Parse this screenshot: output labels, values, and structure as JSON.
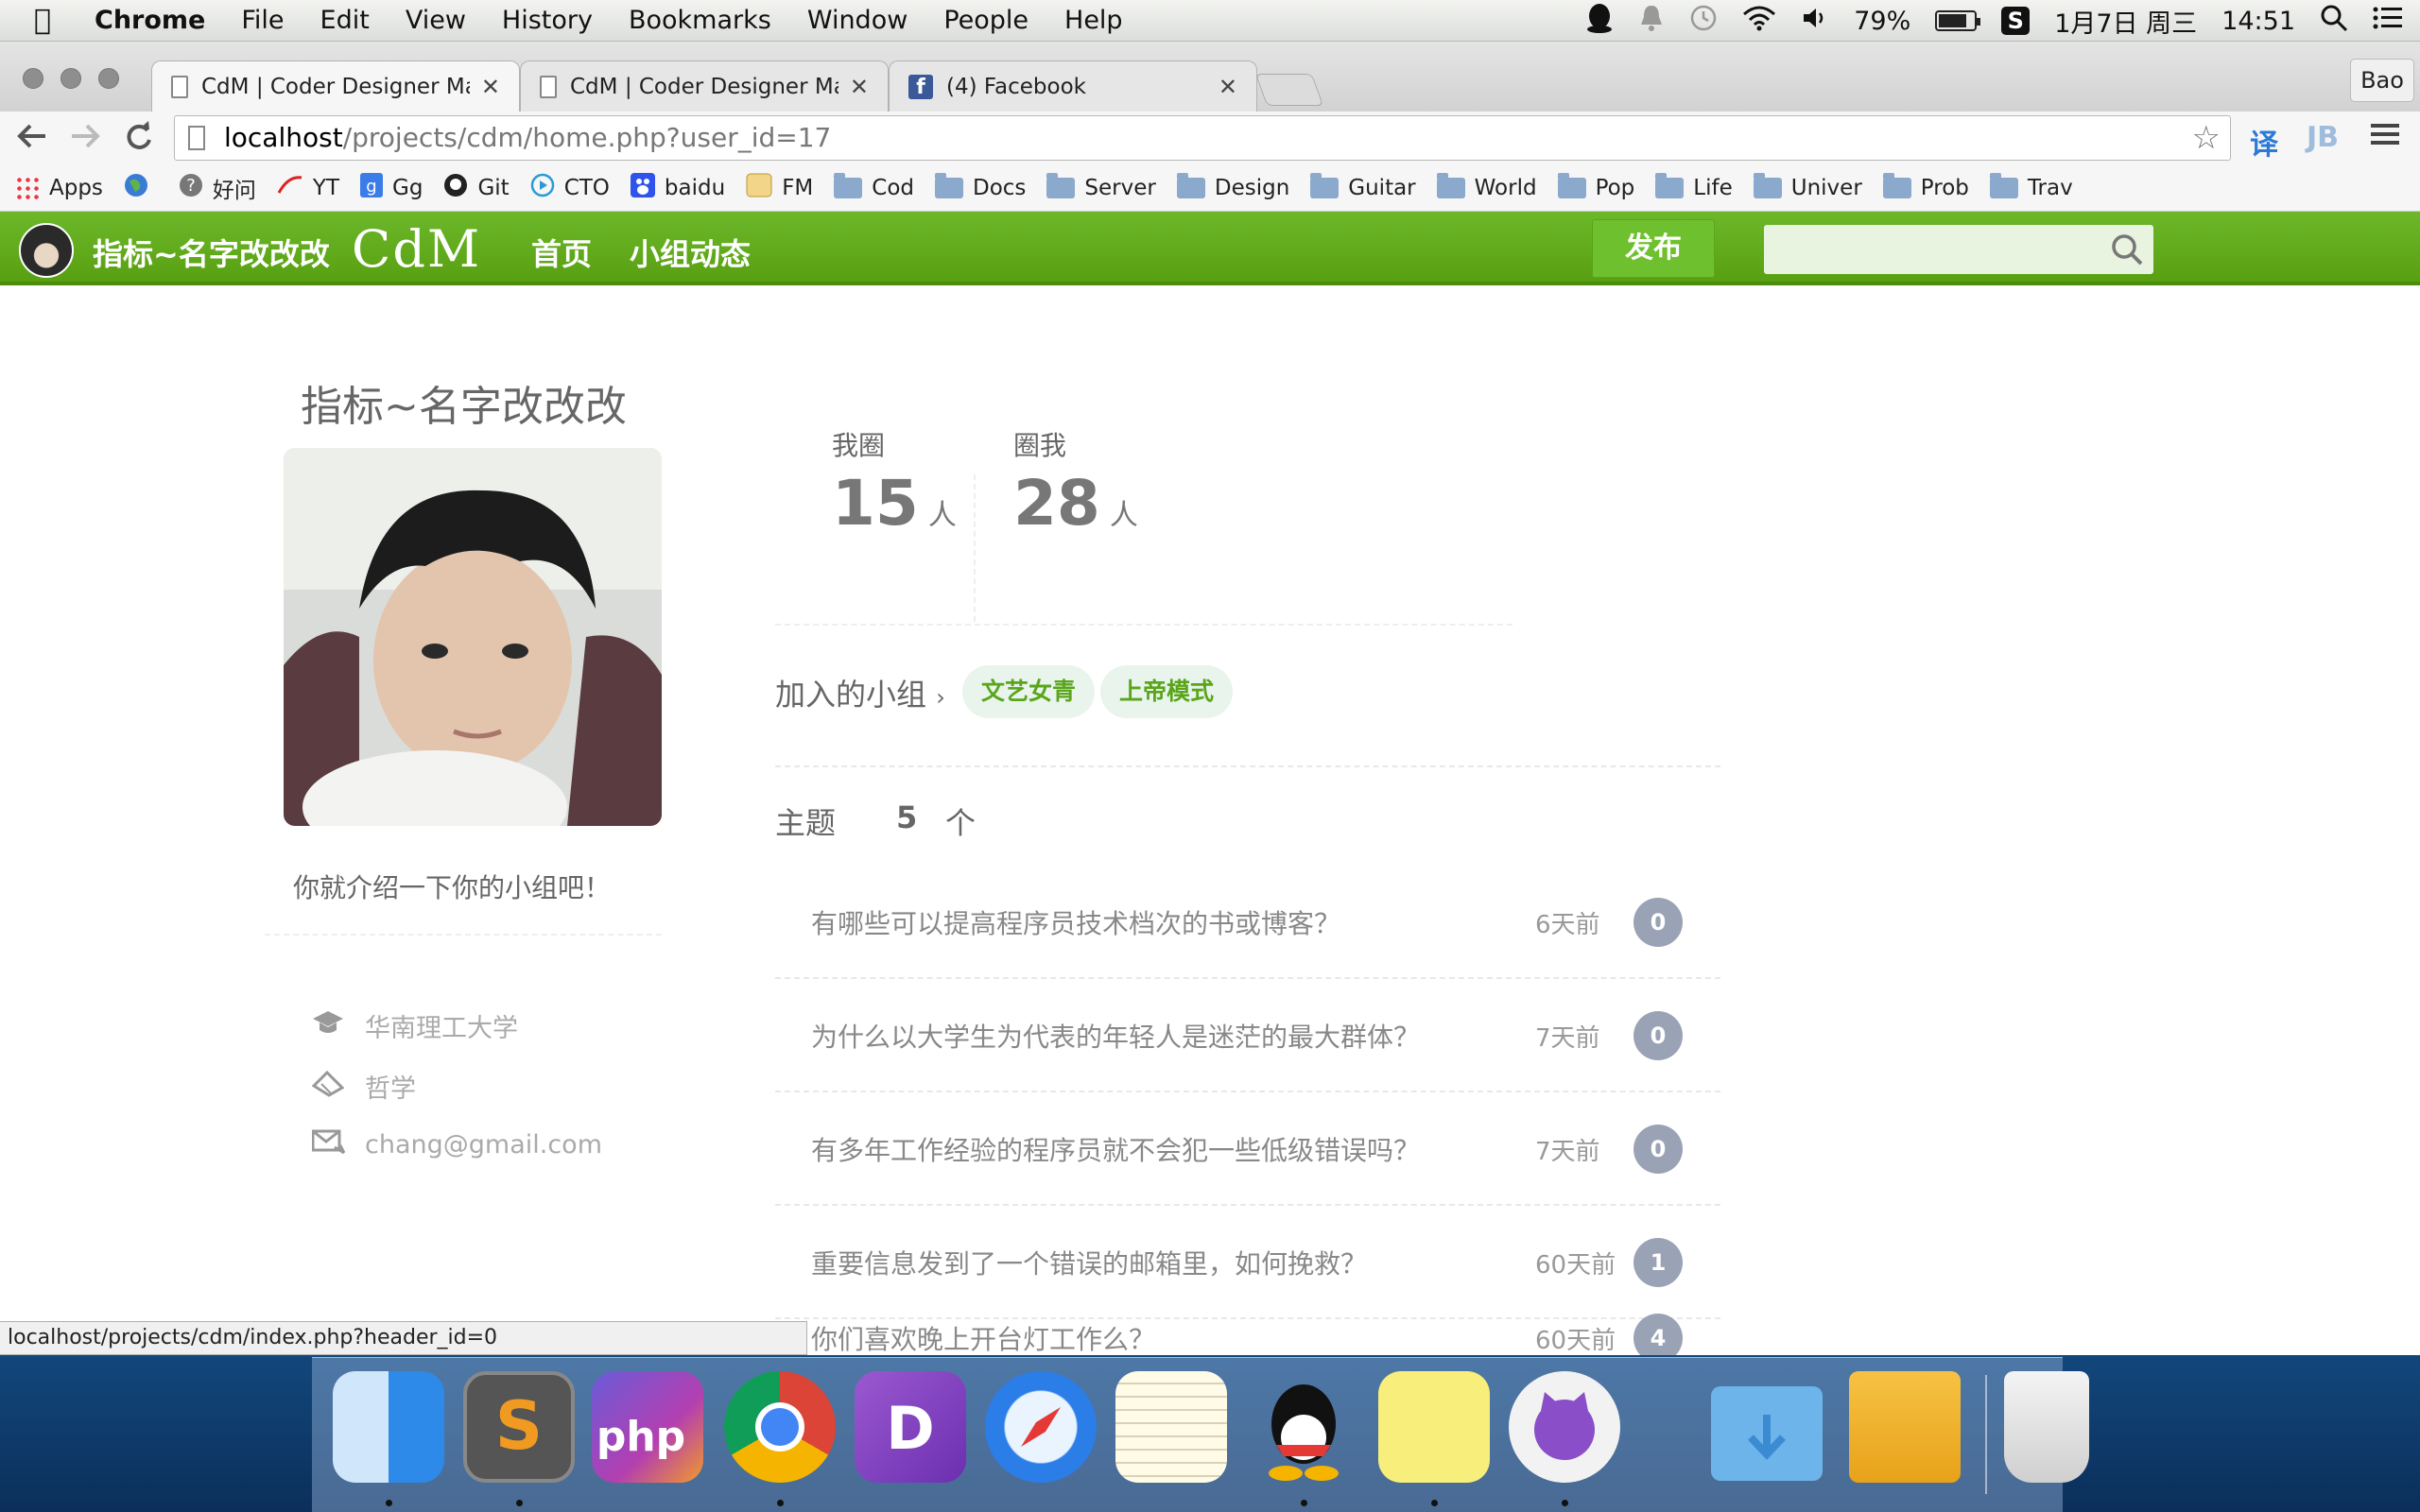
{
  "menubar": {
    "app": "Chrome",
    "items": [
      "File",
      "Edit",
      "View",
      "History",
      "Bookmarks",
      "Window",
      "People",
      "Help"
    ],
    "battery": "79%",
    "battery_level": 0.79,
    "date": "1月7日 周三",
    "time": "14:51"
  },
  "browser": {
    "tabs": [
      {
        "title": "CdM | Coder Designer Man"
      },
      {
        "title": "CdM | Coder Designer Man"
      },
      {
        "title": "(4) Facebook"
      }
    ],
    "profile": "Bao",
    "url_host": "localhost",
    "url_path": "/projects/cdm/home.php?user_id=17",
    "bookmarks": [
      "Apps",
      "好问",
      "YT",
      "Gg",
      "Git",
      "CTO",
      "baidu",
      "FM",
      "Cod",
      "Docs",
      "Server",
      "Design",
      "Guitar",
      "World",
      "Pop",
      "Life",
      "Univer",
      "Prob",
      "Trav"
    ],
    "status_url": "localhost/projects/cdm/index.php?header_id=0"
  },
  "site": {
    "username": "指标~名字改改改",
    "logo": "CdM",
    "nav": [
      "首页",
      "小组动态"
    ],
    "publish": "发布",
    "search_placeholder": ""
  },
  "profile": {
    "name": "指标~名字改改改",
    "intro": "你就介绍一下你的小组吧！",
    "school": "华南理工大学",
    "major": "哲学",
    "email": "chang@gmail.com",
    "stats": [
      {
        "label": "我圈",
        "value": "15",
        "unit": "人"
      },
      {
        "label": "圈我",
        "value": "28",
        "unit": "人"
      }
    ],
    "groups_label": "加入的小组",
    "groups": [
      "文艺女青",
      "上帝模式"
    ],
    "topics_label": "主题",
    "topics_count": "5",
    "topics_unit": "个",
    "topics": [
      {
        "title": "有哪些可以提高程序员技术档次的书或博客？",
        "time": "6天前",
        "count": "0"
      },
      {
        "title": "为什么以大学生为代表的年轻人是迷茫的最大群体？",
        "time": "7天前",
        "count": "0"
      },
      {
        "title": "有多年工作经验的程序员就不会犯一些低级错误吗？",
        "time": "7天前",
        "count": "0"
      },
      {
        "title": "重要信息发到了一个错误的邮箱里，如何挽救？",
        "time": "60天前",
        "count": "1"
      },
      {
        "title": "你们喜欢晚上开台灯工作么？",
        "time": "60天前",
        "count": "4"
      }
    ]
  },
  "dock": {
    "apps": [
      "finder-icon",
      "sublime-icon",
      "phpstorm-icon",
      "chrome-icon",
      "dash-icon",
      "safari-icon",
      "notes-icon",
      "qq-icon",
      "stickies-icon",
      "github-icon",
      "downloads-folder-icon",
      "drive-icon",
      "trash-icon"
    ]
  }
}
